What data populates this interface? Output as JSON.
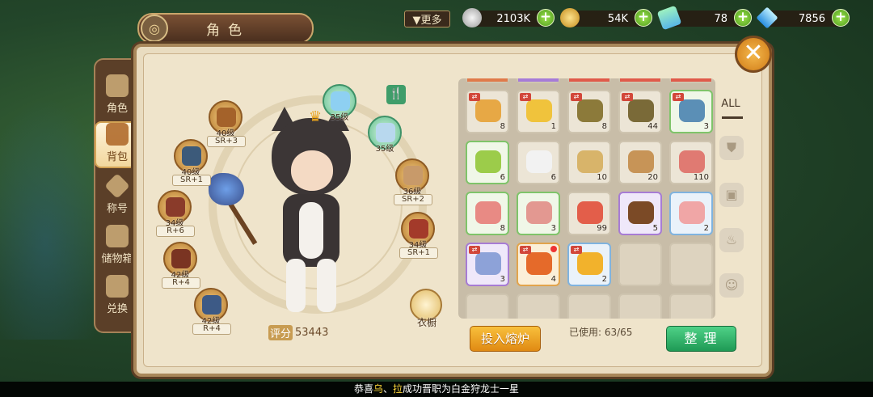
{
  "header": {
    "title": "角色",
    "more_label": "▼更多"
  },
  "currencies": [
    {
      "name": "silver-coin",
      "value": "2103K",
      "color": "#c8c8c8"
    },
    {
      "name": "gold-coin",
      "value": "54K",
      "color": "#e8b63a"
    },
    {
      "name": "rainbow-ticket",
      "value": "78",
      "color": "#7fd6a2"
    },
    {
      "name": "diamond",
      "value": "7856",
      "color": "#4ab3f4"
    }
  ],
  "nav": [
    {
      "label": "角色"
    },
    {
      "label": "背包"
    },
    {
      "label": "称号"
    },
    {
      "label": "储物箱"
    },
    {
      "label": "兑换"
    }
  ],
  "character": {
    "score_label": "评分",
    "score": "53443",
    "wardrobe_label": "衣橱",
    "equipment": [
      {
        "level": "40级",
        "rank": "SR+3"
      },
      {
        "level": "40级",
        "rank": "SR+1"
      },
      {
        "level": "34级",
        "rank": "R+6"
      },
      {
        "level": "42级",
        "rank": "R+4"
      },
      {
        "level": "42级",
        "rank": "R+4"
      },
      {
        "level": "35级",
        "rank": ""
      },
      {
        "level": "35级",
        "rank": ""
      },
      {
        "level": "36级",
        "rank": "SR+2"
      },
      {
        "level": "34级",
        "rank": "SR+1"
      }
    ]
  },
  "bag": {
    "filter_all": "ALL",
    "items": [
      {
        "name": "fried-fish",
        "count": "8",
        "color": "#e7a845"
      },
      {
        "name": "golden-carp",
        "count": "1",
        "color": "#f0c33c"
      },
      {
        "name": "brown-fish",
        "count": "8",
        "color": "#8c7a3a"
      },
      {
        "name": "brown-fish",
        "count": "44",
        "color": "#7a6a38"
      },
      {
        "name": "blue-fish",
        "count": "3",
        "color": "#5b8fb6"
      },
      {
        "name": "hop",
        "count": "6",
        "color": "#9ccc4a"
      },
      {
        "name": "salt",
        "count": "6",
        "color": "#f2f2f2"
      },
      {
        "name": "bamboo-shoot",
        "count": "10",
        "color": "#d8b46a"
      },
      {
        "name": "mushroom",
        "count": "20",
        "color": "#c79457"
      },
      {
        "name": "bacon",
        "count": "110",
        "color": "#e07a72"
      },
      {
        "name": "pork-belly",
        "count": "8",
        "color": "#e88a84"
      },
      {
        "name": "pork-belly",
        "count": "3",
        "color": "#e39891"
      },
      {
        "name": "shrimp",
        "count": "99",
        "color": "#e35e4a"
      },
      {
        "name": "chocolate",
        "count": "5",
        "color": "#7b4a26"
      },
      {
        "name": "ham",
        "count": "2",
        "color": "#f0a6a6"
      },
      {
        "name": "gem-crystal",
        "count": "3",
        "color": "#8da2d8"
      },
      {
        "name": "fire-stone",
        "count": "4",
        "color": "#e56a2a"
      },
      {
        "name": "gold-scroll",
        "count": "2",
        "color": "#f2b22c"
      }
    ],
    "smelt_label": "投入熔炉",
    "used_label": "已使用: 63/65",
    "sort_label": "整理"
  },
  "ticker": {
    "prefix": "恭喜",
    "name1": "乌",
    "sep": "、",
    "name2": "拉",
    "suffix": "成功晋职为白金狩龙士一星"
  },
  "close_label": "✕"
}
